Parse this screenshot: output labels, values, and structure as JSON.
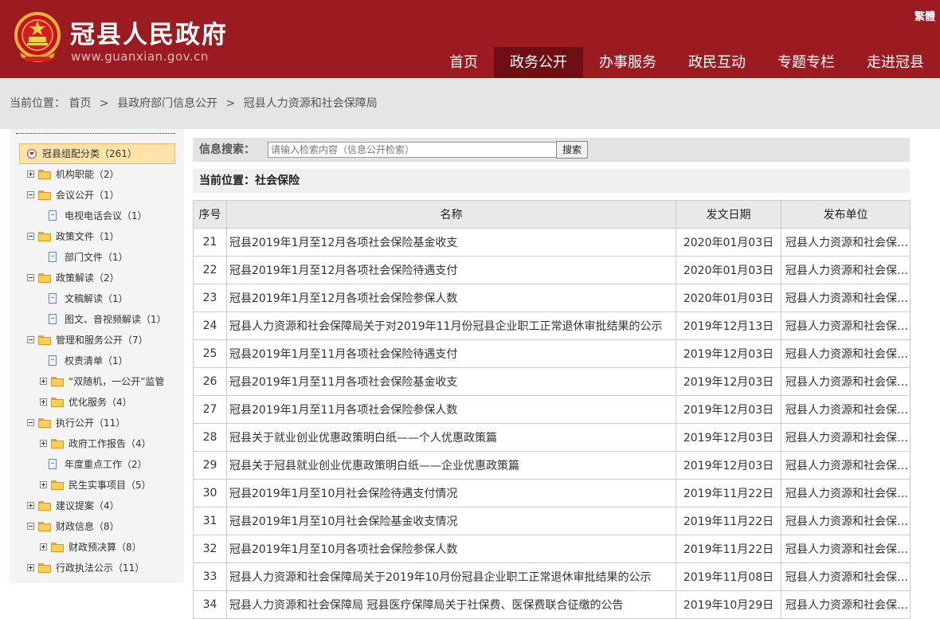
{
  "header": {
    "title": "冠县人民政府",
    "url": "www.guanxian.gov.cn",
    "traditional_label": "繁體",
    "nav": [
      {
        "label": "首页"
      },
      {
        "label": "政务公开",
        "active": true
      },
      {
        "label": "办事服务"
      },
      {
        "label": "政民互动"
      },
      {
        "label": "专题专栏"
      },
      {
        "label": "走进冠县"
      }
    ]
  },
  "breadcrumb": {
    "prefix": "当前位置：",
    "items": [
      "首页",
      "县政府部门信息公开",
      "冠县人力资源和社会保障局"
    ],
    "separator": ">"
  },
  "sidebar": {
    "root": "冠县组配分类（261）",
    "nodes": [
      {
        "label": "机构职能（2）",
        "level": 0,
        "toggle": "plus",
        "icon": "folder"
      },
      {
        "label": "会议公开（1）",
        "level": 0,
        "toggle": "minus",
        "icon": "folder"
      },
      {
        "label": "电视电话会议（1）",
        "level": 1,
        "toggle": "none",
        "icon": "page"
      },
      {
        "label": "政策文件（1）",
        "level": 0,
        "toggle": "minus",
        "icon": "folder"
      },
      {
        "label": "部门文件（1）",
        "level": 1,
        "toggle": "none",
        "icon": "page"
      },
      {
        "label": "政策解读（2）",
        "level": 0,
        "toggle": "minus",
        "icon": "folder"
      },
      {
        "label": "文稿解读（1）",
        "level": 1,
        "toggle": "none",
        "icon": "page"
      },
      {
        "label": "图文、音视频解读（1）",
        "level": 1,
        "toggle": "none",
        "icon": "page"
      },
      {
        "label": "管理和服务公开（7）",
        "level": 0,
        "toggle": "minus",
        "icon": "folder"
      },
      {
        "label": "权责清单（1）",
        "level": 1,
        "toggle": "none",
        "icon": "page"
      },
      {
        "label": "“双随机，一公开”监管",
        "level": 1,
        "toggle": "plus",
        "icon": "folder"
      },
      {
        "label": "优化服务（4）",
        "level": 1,
        "toggle": "plus",
        "icon": "folder"
      },
      {
        "label": "执行公开（11）",
        "level": 0,
        "toggle": "minus",
        "icon": "folder"
      },
      {
        "label": "政府工作报告（4）",
        "level": 1,
        "toggle": "plus",
        "icon": "folder"
      },
      {
        "label": "年度重点工作（2）",
        "level": 1,
        "toggle": "none",
        "icon": "page"
      },
      {
        "label": "民生实事项目（5）",
        "level": 1,
        "toggle": "plus",
        "icon": "folder"
      },
      {
        "label": "建议提案（4）",
        "level": 0,
        "toggle": "plus",
        "icon": "folder"
      },
      {
        "label": "财政信息（8）",
        "level": 0,
        "toggle": "minus",
        "icon": "folder"
      },
      {
        "label": "财政预决算（8）",
        "level": 1,
        "toggle": "plus",
        "icon": "folder"
      },
      {
        "label": "行政执法公示（11）",
        "level": 0,
        "toggle": "plus",
        "icon": "folder"
      }
    ]
  },
  "search": {
    "label": "信息搜索：",
    "placeholder": "请输入检索内容（信息公开检索）",
    "button": "搜索"
  },
  "location": {
    "text": "当前位置：社会保险"
  },
  "table": {
    "columns": [
      "序号",
      "名称",
      "发文日期",
      "发布单位"
    ],
    "rows": [
      {
        "no": "21",
        "name": "冠县2019年1月至12月各项社会保险基金收支",
        "date": "2020年01月03日",
        "unit": "冠县人力资源和社会保障局"
      },
      {
        "no": "22",
        "name": "冠县2019年1月至12月各项社会保险待遇支付",
        "date": "2020年01月03日",
        "unit": "冠县人力资源和社会保障局"
      },
      {
        "no": "23",
        "name": "冠县2019年1月至12月各项社会保险参保人数",
        "date": "2020年01月03日",
        "unit": "冠县人力资源和社会保障局"
      },
      {
        "no": "24",
        "name": "冠县人力资源和社会保障局关于对2019年11月份冠县企业职工正常退休审批结果的公示",
        "date": "2019年12月13日",
        "unit": "冠县人力资源和社会保障局"
      },
      {
        "no": "25",
        "name": "冠县2019年1月至11月各项社会保险待遇支付",
        "date": "2019年12月03日",
        "unit": "冠县人力资源和社会保障局"
      },
      {
        "no": "26",
        "name": "冠县2019年1月至11月各项社会保险基金收支",
        "date": "2019年12月03日",
        "unit": "冠县人力资源和社会保障局"
      },
      {
        "no": "27",
        "name": "冠县2019年1月至11月各项社会保险参保人数",
        "date": "2019年12月03日",
        "unit": "冠县人力资源和社会保障局"
      },
      {
        "no": "28",
        "name": "冠县关于就业创业优惠政策明白纸——个人优惠政策篇",
        "date": "2019年12月03日",
        "unit": "冠县人力资源和社会保障局"
      },
      {
        "no": "29",
        "name": "冠县关于冠县就业创业优惠政策明白纸——企业优惠政策篇",
        "date": "2019年12月03日",
        "unit": "冠县人力资源和社会保障局"
      },
      {
        "no": "30",
        "name": "冠县2019年1月至10月社会保险待遇支付情况",
        "date": "2019年11月22日",
        "unit": "冠县人力资源和社会保障局"
      },
      {
        "no": "31",
        "name": "冠县2019年1月至10月社会保险基金收支情况",
        "date": "2019年11月22日",
        "unit": "冠县人力资源和社会保障局"
      },
      {
        "no": "32",
        "name": "冠县2019年1月至10月各项社会保险参保人数",
        "date": "2019年11月22日",
        "unit": "冠县人力资源和社会保障局"
      },
      {
        "no": "33",
        "name": "冠县人力资源和社会保障局关于2019年10月份冠县企业职工正常退休审批结果的公示",
        "date": "2019年11月08日",
        "unit": "冠县人力资源和社会保障局"
      },
      {
        "no": "34",
        "name": "冠县人力资源和社会保障局 冠县医疗保障局关于社保费、医保费联合征缴的公告",
        "date": "2019年10月29日",
        "unit": "冠县人力资源和社会保障局"
      }
    ]
  },
  "colors": {
    "header_bg": "#9c1b20",
    "nav_active_bg": "#6f0f13",
    "crumb_bg": "#e5e5e5",
    "tree_root_bg": "#ffe3a8"
  }
}
